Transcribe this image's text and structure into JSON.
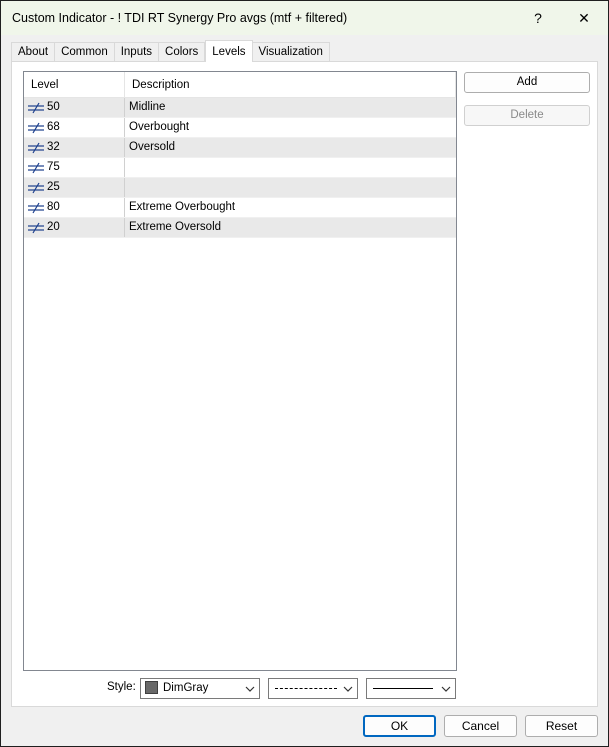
{
  "window": {
    "title": "Custom Indicator - ! TDI RT Synergy Pro avgs  (mtf + filtered)",
    "help_glyph": "?",
    "close_glyph": "✕"
  },
  "tabs": [
    {
      "label": "About"
    },
    {
      "label": "Common"
    },
    {
      "label": "Inputs"
    },
    {
      "label": "Colors"
    },
    {
      "label": "Levels",
      "active": true
    },
    {
      "label": "Visualization"
    }
  ],
  "levels_table": {
    "columns": {
      "level": "Level",
      "description": "Description"
    },
    "rows": [
      {
        "level": "50",
        "description": "Midline"
      },
      {
        "level": "68",
        "description": "Overbought"
      },
      {
        "level": "32",
        "description": "Oversold"
      },
      {
        "level": "75",
        "description": ""
      },
      {
        "level": "25",
        "description": ""
      },
      {
        "level": "80",
        "description": "Extreme Overbought"
      },
      {
        "level": "20",
        "description": "Extreme Oversold"
      }
    ],
    "row_icon": "level-line-icon"
  },
  "buttons": {
    "add": "Add",
    "delete": "Delete"
  },
  "style": {
    "label": "Style:",
    "color_name": "DimGray",
    "color_hex": "#696969",
    "line_style": "dashed",
    "line_width": "solid"
  },
  "footer": {
    "ok": "OK",
    "cancel": "Cancel",
    "reset": "Reset"
  }
}
